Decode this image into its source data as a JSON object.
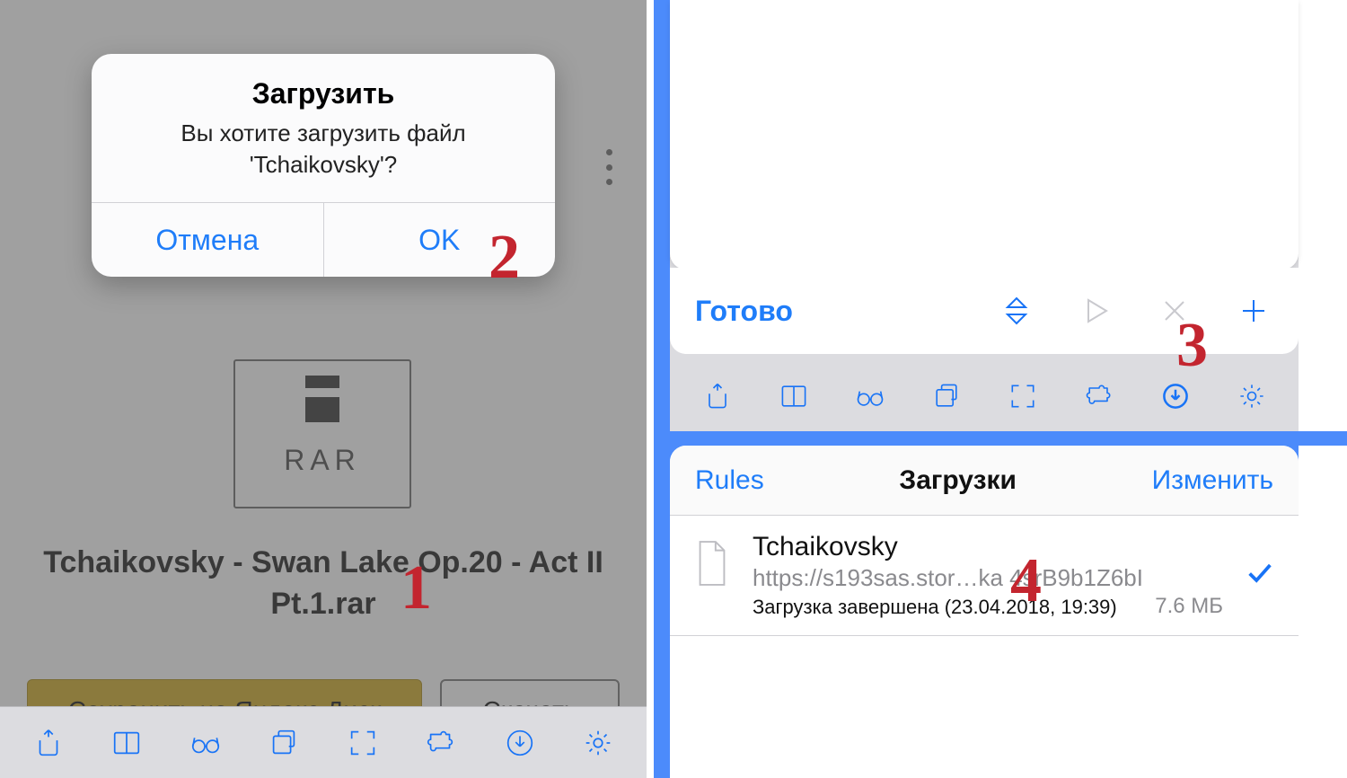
{
  "left": {
    "file_type_label": "RAR",
    "file_title": "Tchaikovsky - Swan Lake Op.20 - Act II Pt.1.rar",
    "save_btn": "Сохранить на Яндекс.Диск",
    "download_btn": "Скачать",
    "alert": {
      "title": "Загрузить",
      "message": "Вы хотите загрузить файл 'Tchaikovsky'?",
      "cancel": "Отмена",
      "ok": "OK"
    }
  },
  "rt": {
    "done": "Готово"
  },
  "rb": {
    "left_btn": "Rules",
    "title": "Загрузки",
    "right_btn": "Изменить",
    "item": {
      "name": "Tchaikovsky",
      "url": "https://s193sas.stor…ka      4srB9b1Z6bI",
      "status": "Загрузка завершена (23.04.2018, 19:39)",
      "size": "7.6 МБ"
    }
  },
  "steps": {
    "s1": "1",
    "s2": "2",
    "s3": "3",
    "s4": "4"
  },
  "icons": {
    "share": "share-icon",
    "book": "book-icon",
    "glasses": "glasses-icon",
    "tabs": "tabs-icon",
    "fullscreen": "fullscreen-icon",
    "puzzle": "puzzle-icon",
    "download": "download-icon",
    "gear": "gear-icon",
    "sort": "sort-icon",
    "play": "play-icon",
    "close": "close-icon",
    "plus": "plus-icon"
  }
}
